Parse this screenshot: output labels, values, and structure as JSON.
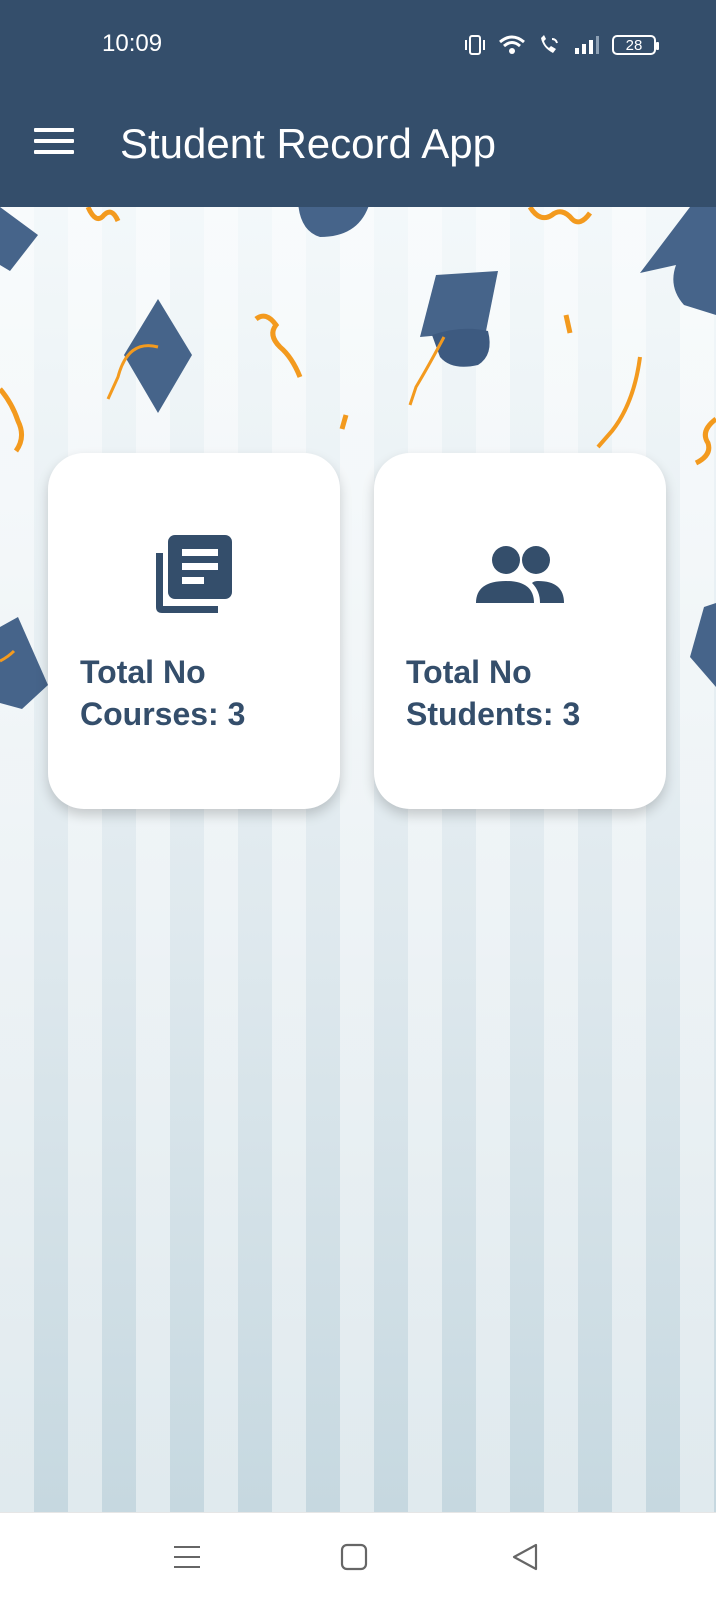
{
  "status_bar": {
    "time": "10:09",
    "battery": "28",
    "icons": [
      "vibrate-icon",
      "wifi-icon",
      "wifi-call-icon",
      "signal-icon",
      "battery-icon"
    ]
  },
  "app_bar": {
    "title": "Student Record App",
    "menu_icon": "menu-icon",
    "background": "#344e6b"
  },
  "cards": [
    {
      "label": "Total No Courses: 3",
      "icon": "library-books-icon"
    },
    {
      "label": "Total No Students: 3",
      "icon": "people-icon"
    }
  ],
  "colors": {
    "primary": "#344e6b",
    "card_text": "#344e6b",
    "confetti": "#f39a1e"
  },
  "nav_bar": {
    "icons": [
      "recent-apps-icon",
      "home-icon",
      "back-icon"
    ]
  }
}
